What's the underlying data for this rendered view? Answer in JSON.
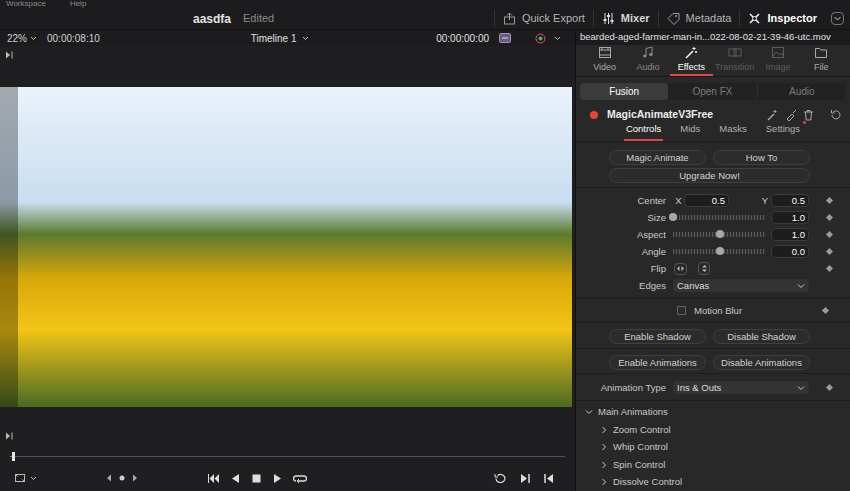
{
  "menu": [
    "Workspace",
    "Help"
  ],
  "project": {
    "title": "aasdfa",
    "status": "Edited"
  },
  "toolbar": [
    {
      "label": "Quick Export",
      "selected": false
    },
    {
      "label": "Mixer",
      "selected": false
    },
    {
      "label": "Metadata",
      "selected": false
    },
    {
      "label": "Inspector",
      "selected": true
    }
  ],
  "viewer": {
    "zoom": "22%",
    "timecode": "00:00:08:10",
    "timeline": "Timeline 1",
    "playhead": "00:00:00:00",
    "scrub_level": 0.005
  },
  "inspector": {
    "clip": "bearded-aged-farmer-man-in...022-08-02-21-39-46-utc.mov",
    "tabs": [
      {
        "label": "Video",
        "selected": false,
        "disabled": false
      },
      {
        "label": "Audio",
        "selected": false,
        "disabled": false
      },
      {
        "label": "Effects",
        "selected": true,
        "disabled": false
      },
      {
        "label": "Transition",
        "selected": false,
        "disabled": true
      },
      {
        "label": "Image",
        "selected": false,
        "disabled": true
      },
      {
        "label": "File",
        "selected": false,
        "disabled": false
      }
    ]
  },
  "effect_tabs": [
    {
      "label": "Fusion",
      "selected": true
    },
    {
      "label": "Open FX",
      "selected": false
    },
    {
      "label": "Audio",
      "selected": false
    }
  ],
  "effect": {
    "name": "MagicAnimateV3Free",
    "enabled": true
  },
  "sub_tabs": [
    {
      "label": "Controls",
      "selected": true,
      "badge": false
    },
    {
      "label": "Mids",
      "selected": false,
      "badge": false
    },
    {
      "label": "Masks",
      "selected": false,
      "badge": false
    },
    {
      "label": "Settings",
      "selected": false,
      "badge": true
    }
  ],
  "actions": [
    "Magic Animate",
    "How To"
  ],
  "upgrade": "Upgrade Now!",
  "center": {
    "label": "Center",
    "x_label": "X",
    "x": "0.5",
    "y_label": "Y",
    "y": "0.5"
  },
  "sliders": [
    {
      "label": "Size",
      "value": "1.0",
      "level": 0.0
    },
    {
      "label": "Aspect",
      "value": "1.0",
      "level": 0.5
    },
    {
      "label": "Angle",
      "value": "0.0",
      "level": 0.5
    }
  ],
  "flip": {
    "label": "Flip"
  },
  "edges": {
    "label": "Edges",
    "value": "Canvas"
  },
  "motion_blur": {
    "label": "Motion Blur",
    "checked": false
  },
  "shadow_buttons": [
    "Enable Shadow",
    "Disable Shadow"
  ],
  "animation_buttons": [
    "Enable Animations",
    "Disable Animations"
  ],
  "animation_type": {
    "label": "Animation Type",
    "value": "Ins & Outs"
  },
  "main_animations": {
    "label": "Main Animations",
    "expanded": true,
    "items": [
      {
        "label": "Zoom Control",
        "expanded": false
      },
      {
        "label": "Whip Control",
        "expanded": false
      },
      {
        "label": "Spin Control",
        "expanded": false
      },
      {
        "label": "Dissolve Control",
        "expanded": false
      }
    ]
  }
}
